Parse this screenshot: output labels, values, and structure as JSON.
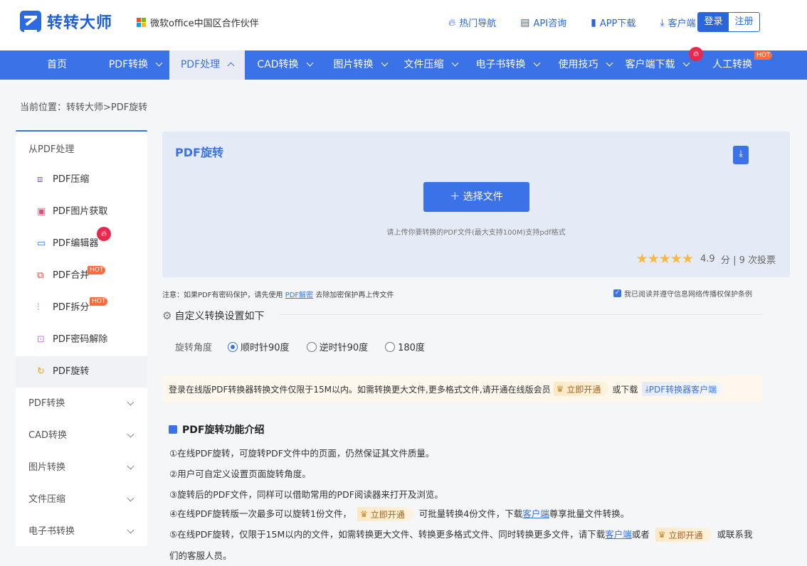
{
  "header": {
    "logo_text": "转转大师",
    "partner_text": "微软office中国区合作伙伴",
    "links": [
      {
        "label": "热门导航",
        "icon": "fire-icon"
      },
      {
        "label": "API咨询",
        "icon": "chat-icon"
      },
      {
        "label": "APP下载",
        "icon": "phone-icon"
      },
      {
        "label": "客户端",
        "icon": "download-icon"
      }
    ],
    "login_label": "登录",
    "register_label": "注册"
  },
  "nav": {
    "items": [
      {
        "label": "首页"
      },
      {
        "label": "PDF转换"
      },
      {
        "label": "PDF处理",
        "active": true
      },
      {
        "label": "CAD转换"
      },
      {
        "label": "图片转换"
      },
      {
        "label": "文件压缩"
      },
      {
        "label": "电子书转换"
      },
      {
        "label": "使用技巧"
      },
      {
        "label": "客户端下载"
      },
      {
        "label": "人工转换"
      }
    ],
    "hot_badge": "HOT"
  },
  "breadcrumb": "当前位置：转转大师>PDF旋转",
  "sidebar": {
    "head": "从PDF处理",
    "items": [
      {
        "label": "PDF压缩"
      },
      {
        "label": "PDF图片获取"
      },
      {
        "label": "PDF编辑器"
      },
      {
        "label": "PDF合并",
        "badge": "HOT"
      },
      {
        "label": "PDF拆分",
        "badge": "HOT"
      },
      {
        "label": "PDF密码解除"
      },
      {
        "label": "PDF旋转",
        "active": true
      }
    ],
    "groups": [
      {
        "label": "PDF转换"
      },
      {
        "label": "CAD转换"
      },
      {
        "label": "图片转换"
      },
      {
        "label": "文件压缩"
      },
      {
        "label": "电子书转换"
      }
    ]
  },
  "upload": {
    "title": "PDF旋转",
    "select_label": "选择文件",
    "hint": "请上传你要转换的PDF文件(最大支持100M)支持pdf格式",
    "stars": "★★★★★",
    "score": "4.9",
    "score_unit": "分",
    "votes": "| 9 次投票"
  },
  "notice": {
    "prefix": "注意：如果PDF有密码保护，请先使用",
    "link": "PDF解密",
    "suffix": "去除加密保护再上传文件",
    "agree": "我已阅读并遵守信息网络传播权保护条例"
  },
  "settings": {
    "title": "自定义转换设置如下",
    "angle_label": "旋转角度",
    "options": [
      {
        "label": "顺时针90度",
        "checked": true
      },
      {
        "label": "逆时针90度",
        "checked": false
      },
      {
        "label": "180度",
        "checked": false
      }
    ]
  },
  "vip": {
    "text": "登录在线版PDF转换器转换文件仅限于15M以内。如需转换更大文件,更多格式文件,请开通在线版会员",
    "open_label": "立即开通",
    "or_download": "或下载",
    "client_label": "PDF转换器客户端"
  },
  "intro": {
    "title": "PDF旋转功能介绍",
    "line1": "①在线PDF旋转，可旋转PDF文件中的页面，仍然保证其文件质量。",
    "line2": "②用户可自定义设置页面旋转角度。",
    "line3": "③旋转后的PDF文件，同样可以借助常用的PDF阅读器来打开及浏览。",
    "line4_a": "④在线PDF旋转版一次最多可以旋转1份文件，",
    "line4_b": "可批量转换4份文件，下载",
    "line4_link": "客户端",
    "line4_c": "尊享批量文件转换。",
    "line5_a": "⑤在线PDF旋转，仅限于15M以内的文件，如需转换更大文件、转换更多格式文件、同时转换更多文件，请下载",
    "line5_link": "客户端",
    "line5_b": "或者",
    "line5_c": "或联系我",
    "line6": "们的客服人员。"
  },
  "colors": {
    "primary": "#3b72e8",
    "hot": "#ff6a3d",
    "fire": "#e8294e",
    "star": "#f7b93e"
  }
}
